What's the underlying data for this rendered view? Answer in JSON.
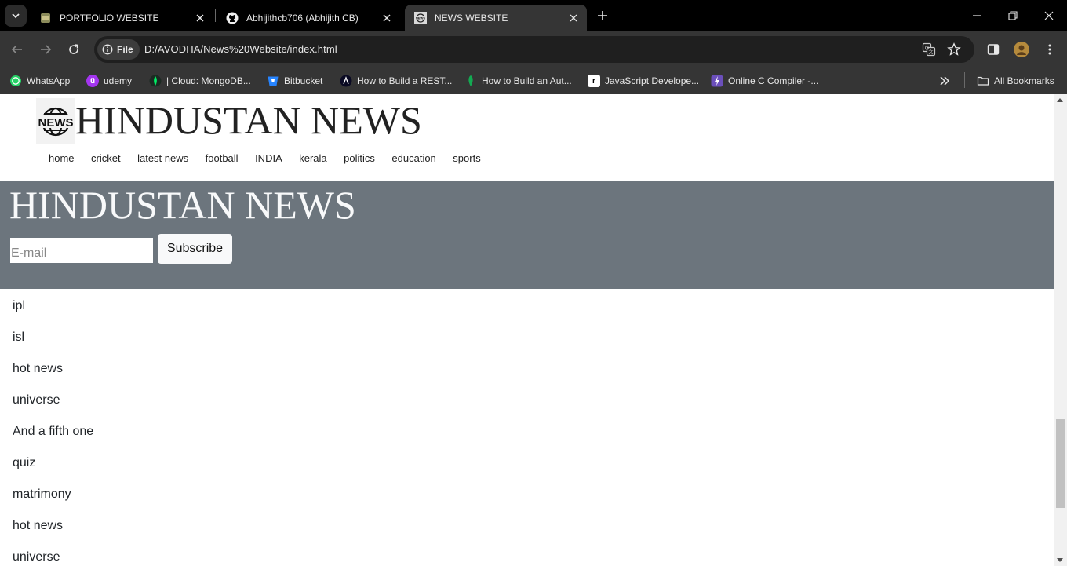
{
  "browser": {
    "tabs": [
      {
        "title": "PORTFOLIO WEBSITE",
        "active": false
      },
      {
        "title": "Abhijithcb706 (Abhijith CB)",
        "active": false
      },
      {
        "title": "NEWS WEBSITE",
        "active": true
      }
    ],
    "chip_label": "File",
    "url": "D:/AVODHA/News%20Website/index.html",
    "bookmarks": [
      {
        "label": "WhatsApp",
        "icon": "whatsapp-icon"
      },
      {
        "label": "udemy",
        "icon": "udemy-icon"
      },
      {
        "label": "| Cloud: MongoDB...",
        "icon": "mongodb-icon"
      },
      {
        "label": "Bitbucket",
        "icon": "bitbucket-icon"
      },
      {
        "label": "How to Build a REST...",
        "icon": "rest-icon"
      },
      {
        "label": "How to Build an Aut...",
        "icon": "auth-icon"
      },
      {
        "label": "JavaScript Develope...",
        "icon": "javascript-icon"
      },
      {
        "label": "Online C Compiler -...",
        "icon": "compiler-icon"
      }
    ],
    "all_bookmarks_label": "All Bookmarks"
  },
  "site": {
    "logo_text": "NEWS",
    "brand": "HINDUSTAN NEWS",
    "nav": [
      "home",
      "cricket",
      "latest news",
      "football",
      "INDIA",
      "kerala",
      "politics",
      "education",
      "sports"
    ],
    "hero_title": "HINDUSTAN NEWS",
    "email_placeholder": "E-mail",
    "subscribe_label": "Subscribe",
    "list_items": [
      "ipl",
      "isl",
      "hot news",
      "universe",
      "And a fifth one",
      "quiz",
      "matrimony",
      "hot news",
      "universe"
    ]
  },
  "colors": {
    "hero_bg": "#6c757d",
    "tab_active": "#353535",
    "toolbar": "#353535"
  }
}
